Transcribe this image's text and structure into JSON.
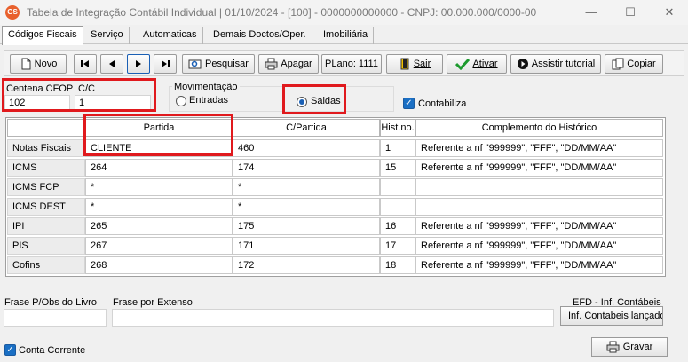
{
  "window": {
    "title": "Tabela de Integração Contábil Individual  |  01/10/2024 - [100] - 0000000000000 - CNPJ: 00.000.000/0000-00",
    "app_icon_text": "GS"
  },
  "tabs": [
    {
      "label": "Códigos Fiscais",
      "active": true
    },
    {
      "label": "Serviço"
    },
    {
      "label": "Automaticas"
    },
    {
      "label": "Demais Doctos/Oper."
    },
    {
      "label": "Imobiliária"
    }
  ],
  "toolbar": {
    "novo": "Novo",
    "pesquisar": "Pesquisar",
    "apagar": "Apagar",
    "plano": "PLano: 1111",
    "sair": "Sair",
    "ativar": "Ativar",
    "assistir": "Assistir tutorial",
    "copiar": "Copiar"
  },
  "form": {
    "centena_label": "Centena CFOP",
    "centena_value": "102",
    "cc_label": "C/C",
    "cc_value": "1",
    "movimentacao_label": "Movimentação",
    "entradas_label": "Entradas",
    "saidas_label": "Saidas",
    "movimentacao_selected": "Saidas",
    "contabiliza_label": "Contabiliza",
    "contabiliza_checked": true
  },
  "grid": {
    "headers": [
      "Partida",
      "C/Partida",
      "Hist.no.",
      "Complemento do Histórico"
    ],
    "rows": [
      {
        "name": "Notas Fiscais",
        "partida": "CLIENTE",
        "cpartida": "460",
        "hist": "1",
        "complemento": "Referente a nf \"999999\", \"FFF\", \"DD/MM/AA\""
      },
      {
        "name": "ICMS",
        "partida": "264",
        "cpartida": "174",
        "hist": "15",
        "complemento": "Referente a nf \"999999\", \"FFF\", \"DD/MM/AA\""
      },
      {
        "name": "ICMS FCP",
        "partida": "*",
        "cpartida": "*",
        "hist": "",
        "complemento": ""
      },
      {
        "name": "ICMS DEST",
        "partida": "*",
        "cpartida": "*",
        "hist": "",
        "complemento": ""
      },
      {
        "name": "IPI",
        "partida": "265",
        "cpartida": "175",
        "hist": "16",
        "complemento": "Referente a nf \"999999\", \"FFF\", \"DD/MM/AA\""
      },
      {
        "name": "PIS",
        "partida": "267",
        "cpartida": "171",
        "hist": "17",
        "complemento": "Referente a nf \"999999\", \"FFF\", \"DD/MM/AA\""
      },
      {
        "name": "Cofins",
        "partida": "268",
        "cpartida": "172",
        "hist": "18",
        "complemento": "Referente a nf \"999999\", \"FFF\", \"DD/MM/AA\""
      }
    ]
  },
  "footer": {
    "frase_obs_label": "Frase P/Obs do Livro",
    "frase_extenso_label": "Frase por Extenso",
    "efd_label": "EFD - Inf. Contábeis",
    "inf_contabeis_button": "Inf. Contabeis lançados",
    "conta_corrente_label": "Conta Corrente",
    "conta_corrente_checked": true,
    "gravar": "Gravar"
  },
  "colors": {
    "highlight_box": "#e0191d",
    "check_blue": "#1a6fc4"
  }
}
